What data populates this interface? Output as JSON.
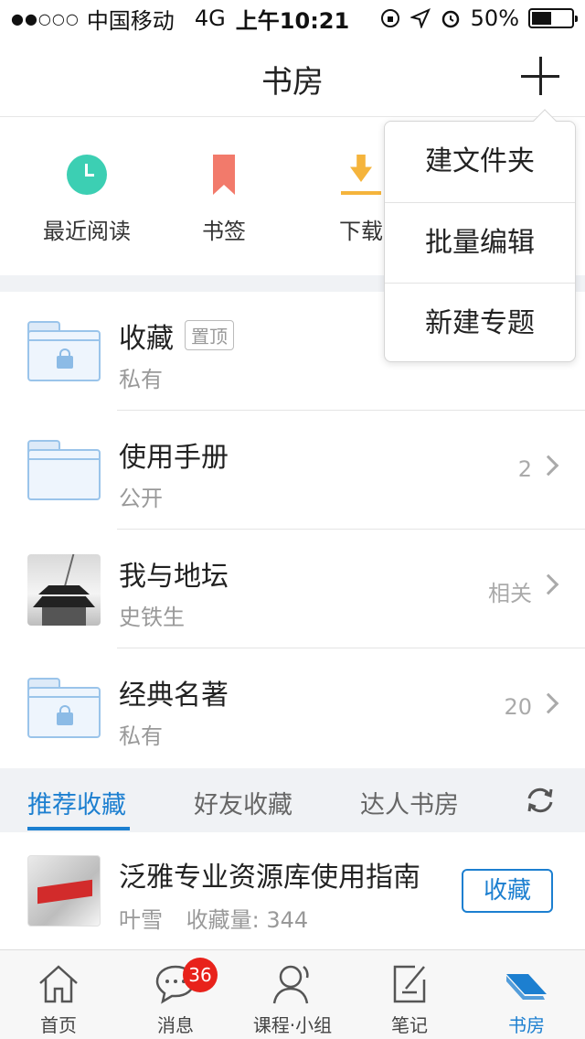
{
  "status_bar": {
    "signal": "●●○○○",
    "carrier": "中国移动",
    "network": "4G",
    "time": "上午10:21",
    "battery_text": "50%",
    "battery_level": 0.5
  },
  "nav": {
    "title": "书房"
  },
  "quick_actions": [
    {
      "label": "最近阅读",
      "icon": "clock-icon"
    },
    {
      "label": "书签",
      "icon": "bookmark-icon"
    },
    {
      "label": "下载",
      "icon": "download-icon"
    }
  ],
  "folders": [
    {
      "name": "收藏",
      "pin": "置顶",
      "sub": "私有",
      "meta": "",
      "icon": "locked-folder-icon"
    },
    {
      "name": "使用手册",
      "sub": "公开",
      "meta": "2",
      "icon": "folder-icon"
    },
    {
      "name": "我与地坛",
      "sub": "史铁生",
      "meta": "相关",
      "icon": "temple-photo"
    },
    {
      "name": "经典名著",
      "sub": "私有",
      "meta": "20",
      "icon": "locked-folder-icon"
    }
  ],
  "tabs": [
    {
      "label": "推荐收藏",
      "active": true
    },
    {
      "label": "好友收藏",
      "active": false
    },
    {
      "label": "达人书房",
      "active": false
    }
  ],
  "recommended": {
    "title": "泛雅专业资源库使用指南",
    "author": "叶雪",
    "count_label": "收藏量: 344",
    "button": "收藏"
  },
  "dropdown": {
    "items": [
      "建文件夹",
      "批量编辑",
      "新建专题"
    ]
  },
  "tabbar": {
    "items": [
      {
        "label": "首页",
        "icon": "home-icon"
      },
      {
        "label": "消息",
        "icon": "message-icon",
        "badge": "36"
      },
      {
        "label": "课程·小组",
        "icon": "user-icon"
      },
      {
        "label": "笔记",
        "icon": "note-icon"
      },
      {
        "label": "书房",
        "icon": "bookshelf-icon",
        "active": true
      }
    ]
  },
  "colors": {
    "accent": "#1c7fd0",
    "badge": "#e8221b",
    "clock": "#3ccfb3",
    "bookmark": "#f27a6b",
    "download": "#f5b43c"
  }
}
